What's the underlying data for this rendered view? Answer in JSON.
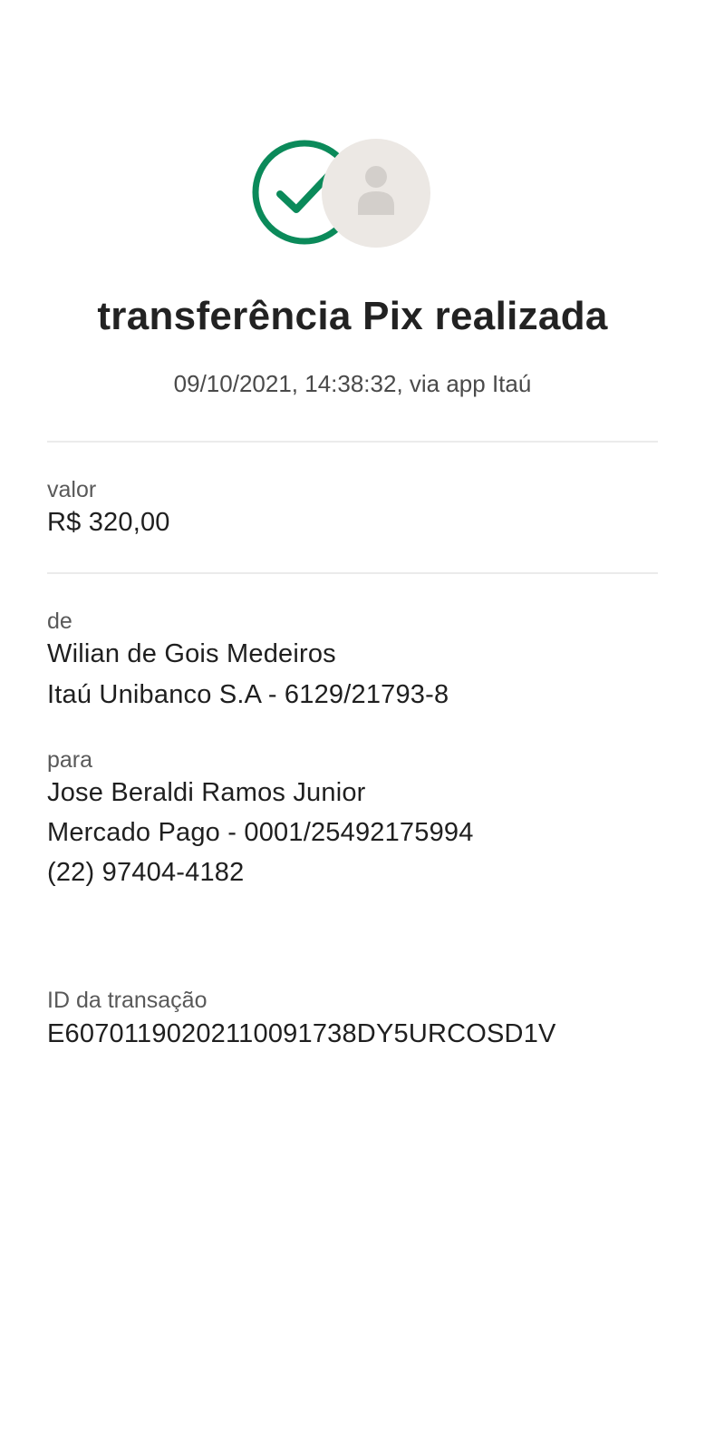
{
  "header": {
    "status_icon": "check-circle-icon",
    "avatar_icon": "person-icon",
    "accent_color": "#0b8a5a",
    "title": "transferência Pix realizada",
    "subtitle": "09/10/2021,  14:38:32, via app Itaú"
  },
  "amount": {
    "label": "valor",
    "value": "R$ 320,00"
  },
  "from": {
    "label": "de",
    "name": "Wilian de Gois Medeiros",
    "bank": "Itaú Unibanco S.A - 6129/21793-8"
  },
  "to": {
    "label": "para",
    "name": "Jose Beraldi Ramos Junior",
    "bank": "Mercado Pago - 0001/25492175994",
    "phone": "(22) 97404-4182"
  },
  "transaction": {
    "label": "ID da transação",
    "id": "E60701190202110091738DY5URCOSD1V"
  }
}
